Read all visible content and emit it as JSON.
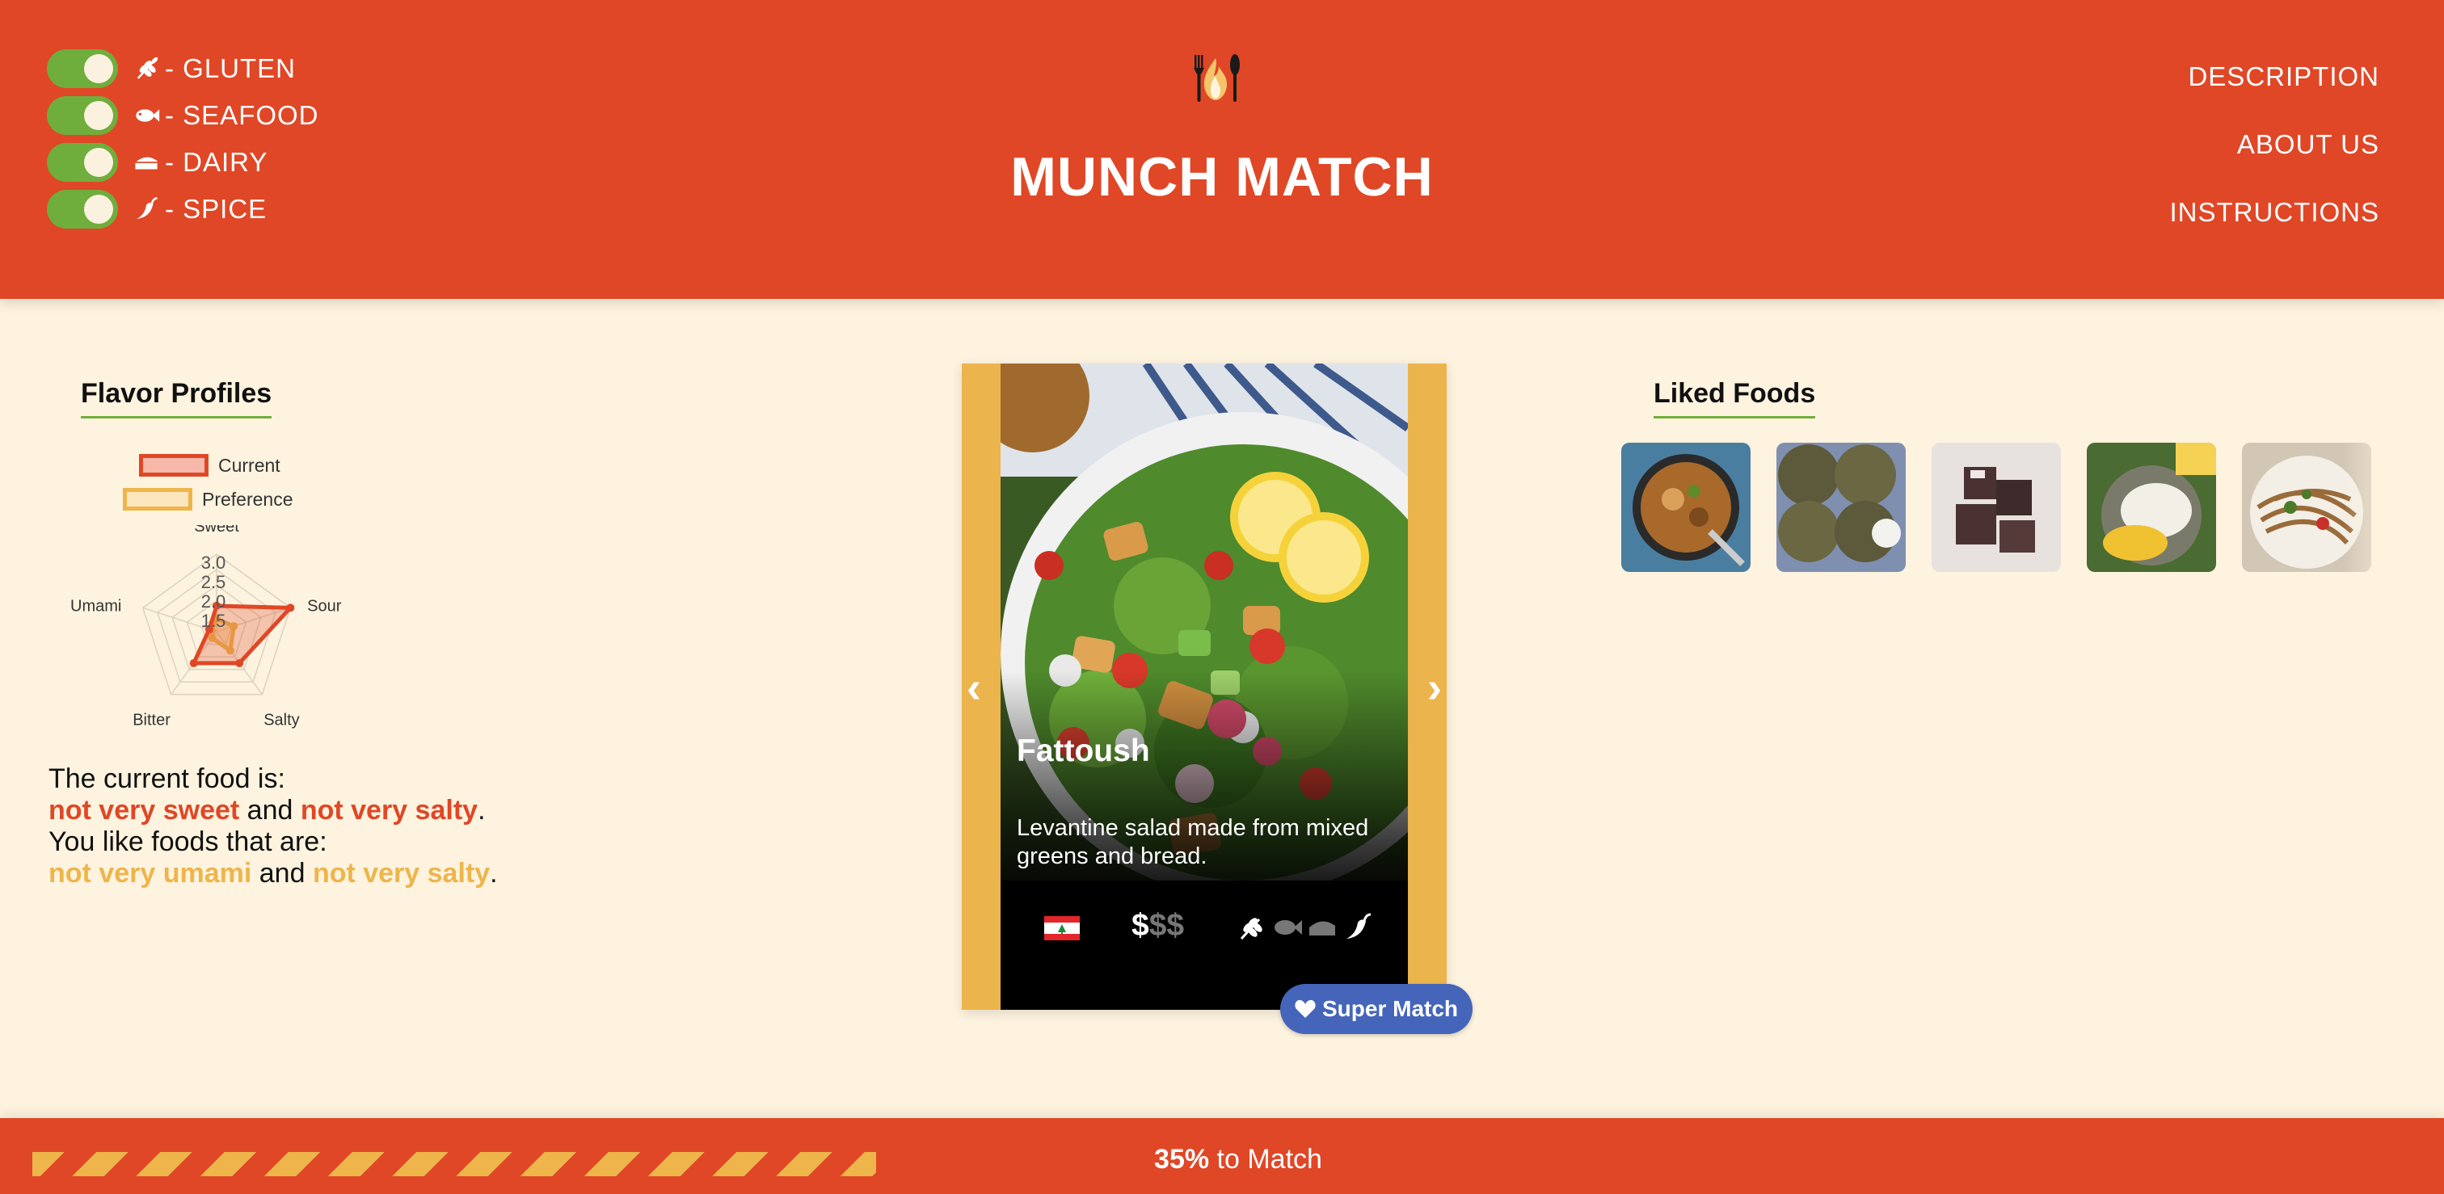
{
  "app": {
    "title": "MUNCH MATCH",
    "logo_icon": "fork-knife-flame-icon"
  },
  "filters": [
    {
      "icon": "wheat-icon",
      "label": "- GLUTEN",
      "enabled": true
    },
    {
      "icon": "fish-icon",
      "label": "- SEAFOOD",
      "enabled": true
    },
    {
      "icon": "cheese-icon",
      "label": "- DAIRY",
      "enabled": true
    },
    {
      "icon": "pepper-icon",
      "label": "- SPICE",
      "enabled": true
    }
  ],
  "nav": [
    {
      "label": "DESCRIPTION"
    },
    {
      "label": "ABOUT US"
    },
    {
      "label": "INSTRUCTIONS"
    }
  ],
  "flavor": {
    "title": "Flavor Profiles",
    "legend": {
      "current": "Current",
      "preference": "Preference"
    },
    "summary": {
      "line1": "The current food is:",
      "current_a": "not very sweet",
      "and1": " and ",
      "current_b": "not very salty",
      "period1": ".",
      "line3": "You like foods that are:",
      "pref_a": "not very umami",
      "and2": " and ",
      "pref_b": "not very salty",
      "period2": "."
    }
  },
  "chart_data": {
    "type": "radar",
    "axes": [
      "Sweet",
      "Sour",
      "Salty",
      "Bitter",
      "Umami"
    ],
    "rlim": [
      0,
      3.0
    ],
    "ticks": [
      "3.0",
      "2.5",
      "2.0",
      "1.5"
    ],
    "series": [
      {
        "name": "Current",
        "color": "#e04726",
        "values": [
          1.0,
          3.0,
          1.5,
          1.5,
          0.3
        ]
      },
      {
        "name": "Preference",
        "color": "#eeb54b",
        "values": [
          0.5,
          0.7,
          0.9,
          0.3,
          0.2
        ]
      }
    ]
  },
  "card": {
    "name": "Fattoush",
    "description": "Levantine salad made from mixed greens and bread.",
    "flag_icon": "lebanon-flag-icon",
    "price_active": "$",
    "price_inactive": "$$",
    "allergen_icons": [
      "wheat-icon",
      "fish-icon",
      "cheese-icon",
      "pepper-icon"
    ],
    "prev": "‹",
    "next": "›"
  },
  "super_match": {
    "label": "Super Match",
    "icon": "heart-icon"
  },
  "liked": {
    "title": "Liked Foods",
    "items": [
      "curry-dish",
      "herb-flatbreads",
      "lamingtons",
      "mango-sticky-rice",
      "noodle-salad"
    ]
  },
  "progress": {
    "percent": 35,
    "percent_label": "35%",
    "suffix": " to Match"
  },
  "colors": {
    "primary": "#e04726",
    "accent": "#eeb54b",
    "toggle": "#6fae3c",
    "background": "#fdf3df",
    "super_match": "#4465ba"
  }
}
